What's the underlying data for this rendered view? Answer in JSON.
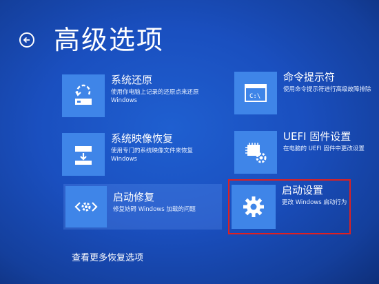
{
  "header": {
    "title": "高级选项"
  },
  "options": [
    {
      "title": "系统还原",
      "description_lines": [
        "使用你电脑上记录的还原点来还原",
        "Windows"
      ],
      "icon": "restore-icon"
    },
    {
      "title": "命令提示符",
      "description_lines": [
        "使用命令提示符进行高级故障排除"
      ],
      "icon": "cmd-icon"
    },
    {
      "title": "系统映像恢复",
      "description_lines": [
        "使用专门的系统映像文件来恢复",
        "Windows"
      ],
      "icon": "image-recovery-icon"
    },
    {
      "title": "UEFI 固件设置",
      "description_lines": [
        "在电脑的 UEFI 固件中更改设置"
      ],
      "icon": "chip-gear-icon"
    },
    {
      "title": "启动修复",
      "description_lines": [
        "修复妨碍 Windows 加载的问题"
      ],
      "icon": "startup-repair-icon"
    },
    {
      "title": "启动设置",
      "description_lines": [
        "更改 Windows 启动行为"
      ],
      "icon": "gear-icon"
    }
  ],
  "footer": {
    "more_label": "查看更多恢复选项"
  },
  "colors": {
    "background": "#1a4fbf",
    "tile": "#3f85e8",
    "highlight": "#e02020"
  }
}
